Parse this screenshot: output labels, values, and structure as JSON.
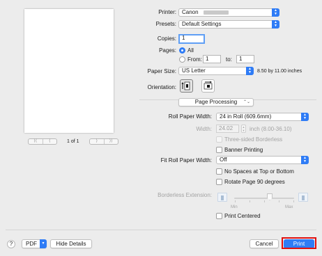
{
  "preview": {
    "page_indicator": "1 of 1",
    "first_prev": [
      "⟨⟨",
      "⟨"
    ],
    "next_last": [
      "⟩",
      "⟩⟩"
    ]
  },
  "printer": {
    "label": "Printer:",
    "value": "Canon"
  },
  "presets": {
    "label": "Presets:",
    "value": "Default Settings"
  },
  "copies": {
    "label": "Copies:",
    "value": "1"
  },
  "pages": {
    "label": "Pages:",
    "all": "All",
    "from": "From:",
    "from_value": "1",
    "to": "to:",
    "to_value": "1",
    "selected": "All"
  },
  "paper_size": {
    "label": "Paper Size:",
    "value": "US Letter",
    "dimensions": "8.50 by 11.00 inches"
  },
  "orientation": {
    "label": "Orientation:",
    "selected": "portrait"
  },
  "section": {
    "value": "Page Processing"
  },
  "roll_paper_width": {
    "label": "Roll Paper Width:",
    "value": "24 in Roll (609.6mm)"
  },
  "width": {
    "label": "Width:",
    "value": "24.02",
    "unit": "inch (8.00-36.10)"
  },
  "options": {
    "three_sided_borderless": "Three-sided Borderless",
    "banner_printing": "Banner Printing",
    "no_spaces": "No Spaces at Top or Bottom",
    "rotate_page": "Rotate Page 90 degrees",
    "print_centered": "Print Centered"
  },
  "fit_roll_paper_width": {
    "label": "Fit Roll Paper Width:",
    "value": "Off"
  },
  "borderless_extension": {
    "label": "Borderless Extension:",
    "min": "Min",
    "max": "Max"
  },
  "footer": {
    "help": "?",
    "pdf": "PDF",
    "hide_details": "Hide Details",
    "cancel": "Cancel",
    "print": "Print"
  },
  "colors": {
    "accent": "#2f7cf6",
    "highlight": "#e01010"
  }
}
